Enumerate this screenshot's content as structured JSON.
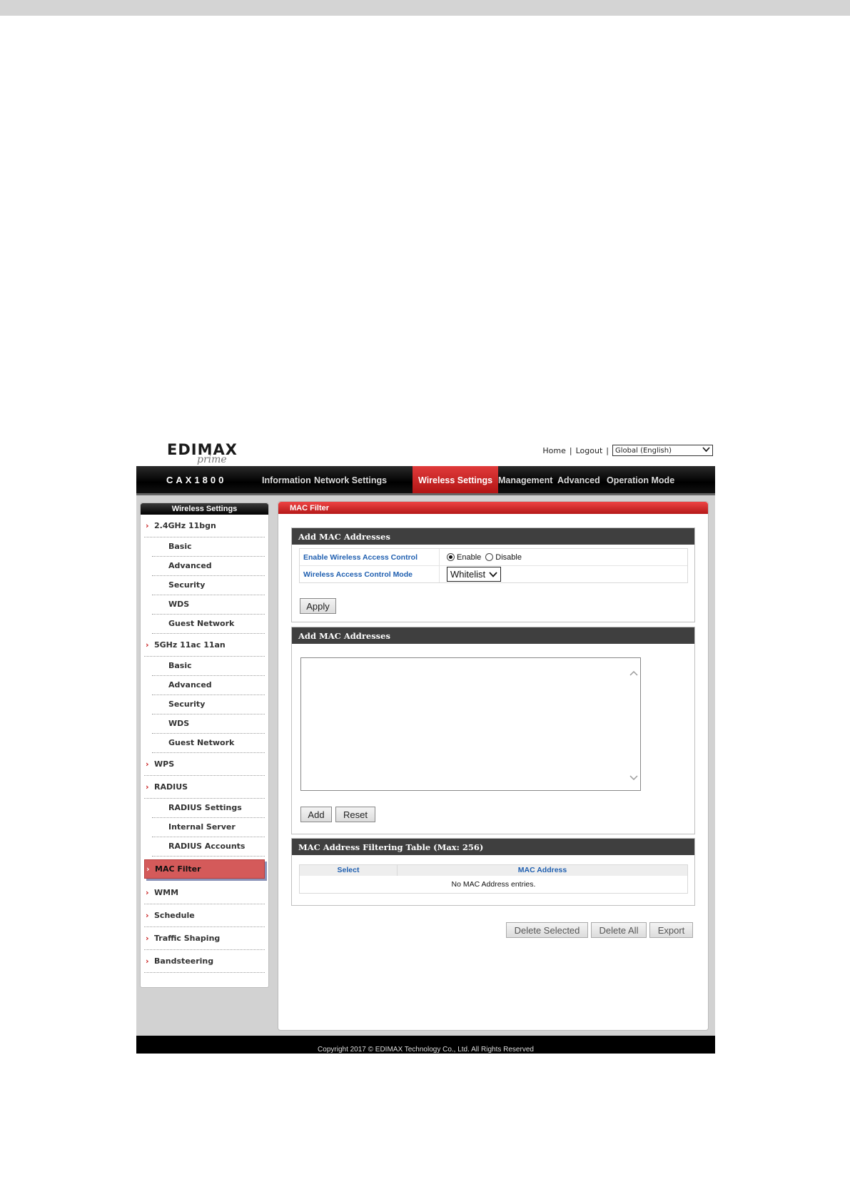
{
  "header": {
    "logo_main": "EDIMAX",
    "logo_sub": "prime",
    "links": {
      "home": "Home",
      "logout": "Logout",
      "sep": "|"
    },
    "language": {
      "selected": "Global (English)"
    }
  },
  "nav": {
    "brand": "CAX1800",
    "items": [
      {
        "label": "Information"
      },
      {
        "label": "Network Settings"
      },
      {
        "label": "Wireless Settings"
      },
      {
        "label": "Management"
      },
      {
        "label": "Advanced"
      },
      {
        "label": "Operation Mode"
      }
    ],
    "active": "Wireless Settings"
  },
  "sidebar": {
    "title": "Wireless Settings",
    "items": [
      {
        "label": "2.4GHz 11bgn",
        "level": "top"
      },
      {
        "label": "Basic",
        "level": "sub"
      },
      {
        "label": "Advanced",
        "level": "sub"
      },
      {
        "label": "Security",
        "level": "sub"
      },
      {
        "label": "WDS",
        "level": "sub"
      },
      {
        "label": "Guest Network",
        "level": "sub"
      },
      {
        "label": "5GHz 11ac 11an",
        "level": "top"
      },
      {
        "label": "Basic",
        "level": "sub"
      },
      {
        "label": "Advanced",
        "level": "sub"
      },
      {
        "label": "Security",
        "level": "sub"
      },
      {
        "label": "WDS",
        "level": "sub"
      },
      {
        "label": "Guest Network",
        "level": "sub"
      },
      {
        "label": "WPS",
        "level": "top"
      },
      {
        "label": "RADIUS",
        "level": "top"
      },
      {
        "label": "RADIUS Settings",
        "level": "sub"
      },
      {
        "label": "Internal Server",
        "level": "sub"
      },
      {
        "label": "RADIUS Accounts",
        "level": "sub"
      },
      {
        "label": "MAC Filter",
        "level": "top",
        "active": true
      },
      {
        "label": "WMM",
        "level": "top"
      },
      {
        "label": "Schedule",
        "level": "top"
      },
      {
        "label": "Traffic Shaping",
        "level": "top"
      },
      {
        "label": "Bandsteering",
        "level": "top"
      }
    ]
  },
  "content": {
    "title": "MAC Filter",
    "section1": {
      "title": "Add MAC Addresses",
      "rows": [
        {
          "label": "Enable Wireless Access Control",
          "options": [
            "Enable",
            "Disable"
          ],
          "selected": "Enable"
        },
        {
          "label": "Wireless Access Control Mode",
          "value": "Whitelist"
        }
      ],
      "apply": "Apply"
    },
    "section2": {
      "title": "Add MAC Addresses",
      "textarea_value": "",
      "add": "Add",
      "reset": "Reset"
    },
    "section3": {
      "title": "MAC Address Filtering Table (Max: 256)",
      "columns": [
        "Select",
        "MAC Address"
      ],
      "empty": "No MAC Address entries."
    },
    "buttons": {
      "delete_selected": "Delete Selected",
      "delete_all": "Delete All",
      "export": "Export"
    }
  },
  "footer": {
    "copyright": "Copyright 2017 © EDIMAX Technology Co., Ltd. All Rights Reserved"
  },
  "colors": {
    "accent_red": "#c81a1a",
    "link_blue": "#1f5fb0",
    "header_dark": "#3f3f3f"
  }
}
